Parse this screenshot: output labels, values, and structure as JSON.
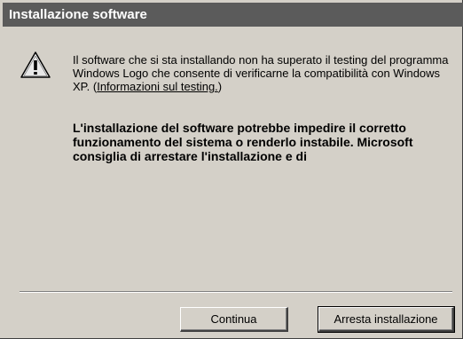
{
  "window": {
    "title": "Installazione software"
  },
  "message": {
    "text_before_link": "Il software che si sta installando non ha superato il testing del programma Windows Logo che consente di verificarne la compatibilità con Windows XP. (",
    "link_text": "Informazioni sul testing.",
    "text_after_link": ")",
    "warning": "L'installazione del software potrebbe impedire il corretto funzionamento del sistema o renderlo instabile. Microsoft consiglia di arrestare l'installazione e di"
  },
  "buttons": {
    "continue_label": "Continua",
    "stop_label": "Arresta installazione"
  },
  "icons": {
    "warning": "warning-icon"
  }
}
